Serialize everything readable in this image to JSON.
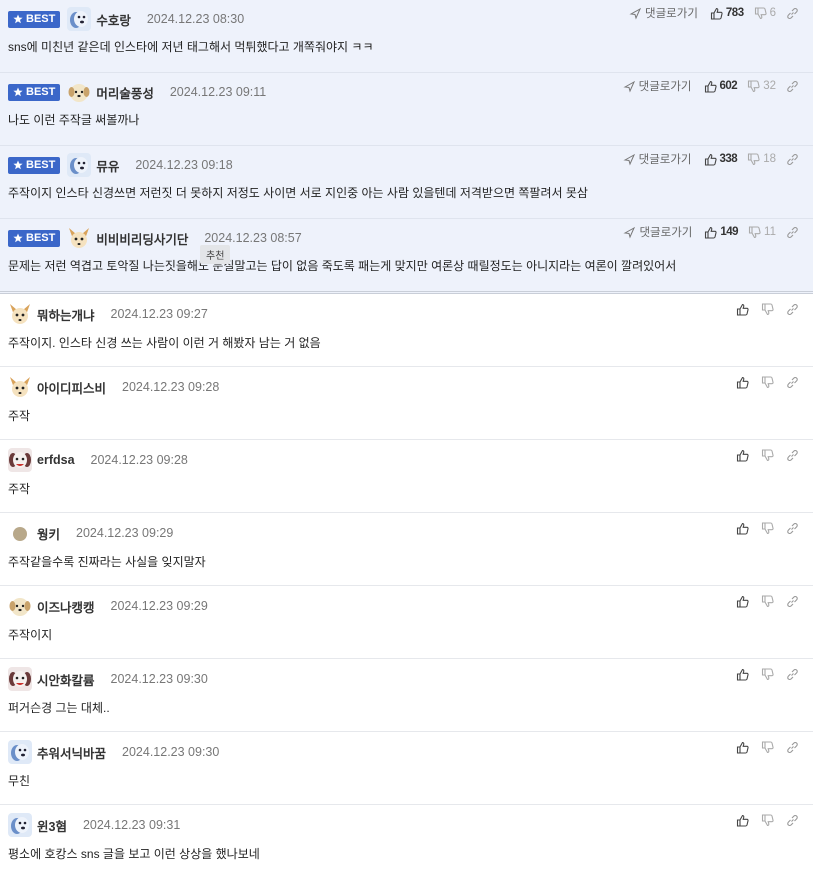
{
  "best_badge_label": "BEST",
  "reply_label": "댓글로가기",
  "tooltip_label": "추천",
  "best_comments": [
    {
      "nickname": "수호랑",
      "date": "2024.12.23 08:30",
      "text": "sns에 미친년 같은데 인스타에 저년 태그해서 먹튀했다고 개쪽줘야지 ㅋㅋ",
      "up": "783",
      "down": "6",
      "avatar": "dog-blue"
    },
    {
      "nickname": "머리술풍성",
      "date": "2024.12.23 09:11",
      "text": "나도 이런 주작글 써볼까나",
      "up": "602",
      "down": "32",
      "avatar": "puppy-round"
    },
    {
      "nickname": "뮤유",
      "date": "2024.12.23 09:18",
      "text": "주작이지 인스타 신경쓰면 저런짓 더 못하지 저정도 사이면 서로 지인중 아는 사람 있을텐데 저격받으면 쪽팔려서 못삼",
      "up": "338",
      "down": "18",
      "avatar": "dog-blue"
    },
    {
      "nickname": "비비비리딩사기단",
      "date": "2024.12.23 08:57",
      "text": "문제는 저런 역겹고 토악질 나는짓을해도 문질말고는 답이 없음 죽도록 패는게 맞지만 여론상 때릴정도는 아니지라는 여론이 깔려있어서",
      "up": "149",
      "down": "11",
      "avatar": "chihuahua"
    }
  ],
  "comments": [
    {
      "nickname": "뭐하는개냐",
      "date": "2024.12.23 09:27",
      "text": "주작이지. 인스타 신경 쓰는 사람이 이런 거 해봤자 남는 거 없음",
      "avatar": "chihuahua"
    },
    {
      "nickname": "아이디피스비",
      "date": "2024.12.23 09:28",
      "text": "주작",
      "avatar": "chihuahua"
    },
    {
      "nickname": "erfdsa",
      "date": "2024.12.23 09:28",
      "text": "주작",
      "avatar": "dog-red"
    },
    {
      "nickname": "웡키",
      "date": "2024.12.23 09:29",
      "text": "주작같을수록 진짜라는 사실을 잊지말자",
      "avatar": "dot"
    },
    {
      "nickname": "이즈나캥캥",
      "date": "2024.12.23 09:29",
      "text": "주작이지",
      "avatar": "puppy-round"
    },
    {
      "nickname": "시안화칼륨",
      "date": "2024.12.23 09:30",
      "text": "퍼거슨경 그는 대체..",
      "avatar": "dog-red"
    },
    {
      "nickname": "추워서닉바꿈",
      "date": "2024.12.23 09:30",
      "text": "무친",
      "avatar": "dog-blue"
    },
    {
      "nickname": "윈3혐",
      "date": "2024.12.23 09:31",
      "text": "평소에 호캉스 sns 글을 보고 이런 상상을 했나보네",
      "avatar": "dog-blue"
    }
  ],
  "colors": {
    "badge": "#3b67c9",
    "best_background": "#eef2fb"
  }
}
